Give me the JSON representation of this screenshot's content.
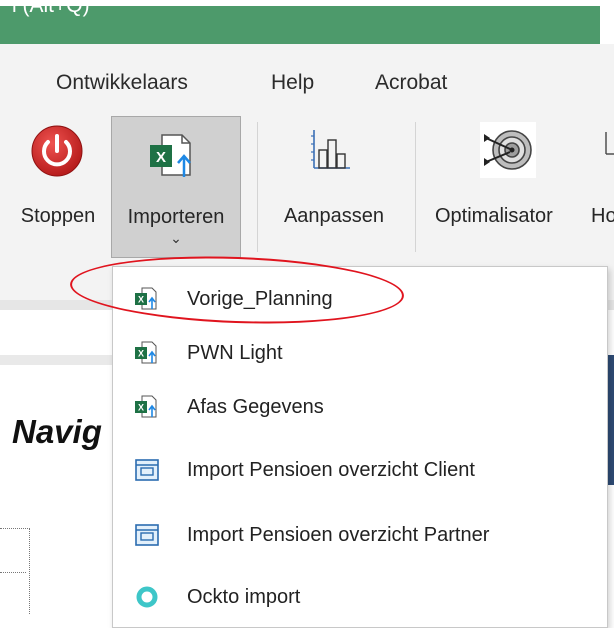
{
  "search": {
    "text": "l (Alt+Q)"
  },
  "menu": {
    "tabs": [
      "Ontwikkelaars",
      "Help",
      "Acrobat"
    ]
  },
  "ribbon": {
    "buttons": [
      {
        "label": "Stoppen",
        "icon": "power-icon"
      },
      {
        "label": "Importeren",
        "icon": "excel-import-icon"
      },
      {
        "label": "Aanpassen",
        "icon": "chart-adjust-icon"
      },
      {
        "label": "Optimalisator",
        "icon": "target-icon"
      },
      {
        "label": "Ho"
      }
    ]
  },
  "sheet": {
    "nav_title": "Navig"
  },
  "dropdown": {
    "items": [
      {
        "label": "Vorige_Planning",
        "icon": "excel-import-icon"
      },
      {
        "label": "PWN Light",
        "icon": "excel-import-icon"
      },
      {
        "label": "Afas Gegevens",
        "icon": "excel-import-icon"
      },
      {
        "label": "Import Pensioen overzicht Client",
        "icon": "window-import-icon"
      },
      {
        "label": "Import Pensioen overzicht Partner",
        "icon": "window-import-icon"
      },
      {
        "label": "Ockto import",
        "icon": "ockto-ring-icon"
      }
    ]
  },
  "colors": {
    "search_bar": "#4d9a6b",
    "annotation": "#e0141e",
    "stop_button": "#c62828"
  }
}
